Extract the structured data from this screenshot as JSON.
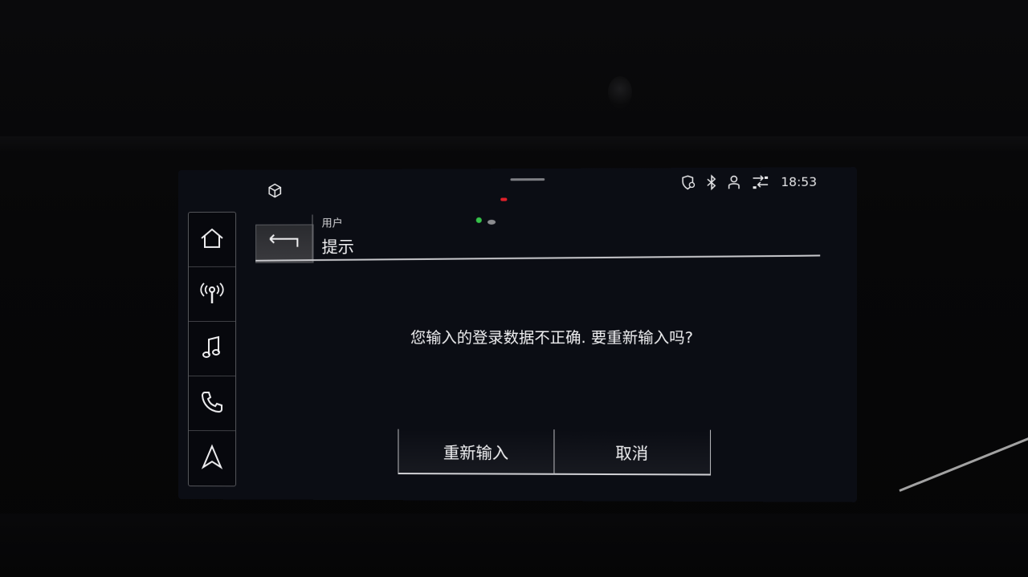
{
  "status_bar": {
    "time": "18:53",
    "icons": [
      "cube-icon",
      "location-shield-icon",
      "bluetooth-icon",
      "user-profile-icon",
      "data-transfer-icon"
    ]
  },
  "sidebar": {
    "items": [
      {
        "name": "home",
        "icon": "home-icon"
      },
      {
        "name": "radio",
        "icon": "radio-antenna-icon"
      },
      {
        "name": "media",
        "icon": "music-note-icon"
      },
      {
        "name": "phone",
        "icon": "phone-icon"
      },
      {
        "name": "navigation",
        "icon": "navigation-arrow-icon"
      }
    ]
  },
  "header": {
    "subtitle": "用户",
    "title": "提示",
    "back_icon": "back-arrow-icon"
  },
  "dialog": {
    "message": "您输入的登录数据不正确. 要重新输入吗?",
    "retry_label": "重新输入",
    "cancel_label": "取消"
  },
  "colors": {
    "screen_bg": "#0b0d14",
    "text": "#f0f0f2",
    "accent_red": "#e0202a",
    "accent_green": "#36c24a"
  }
}
